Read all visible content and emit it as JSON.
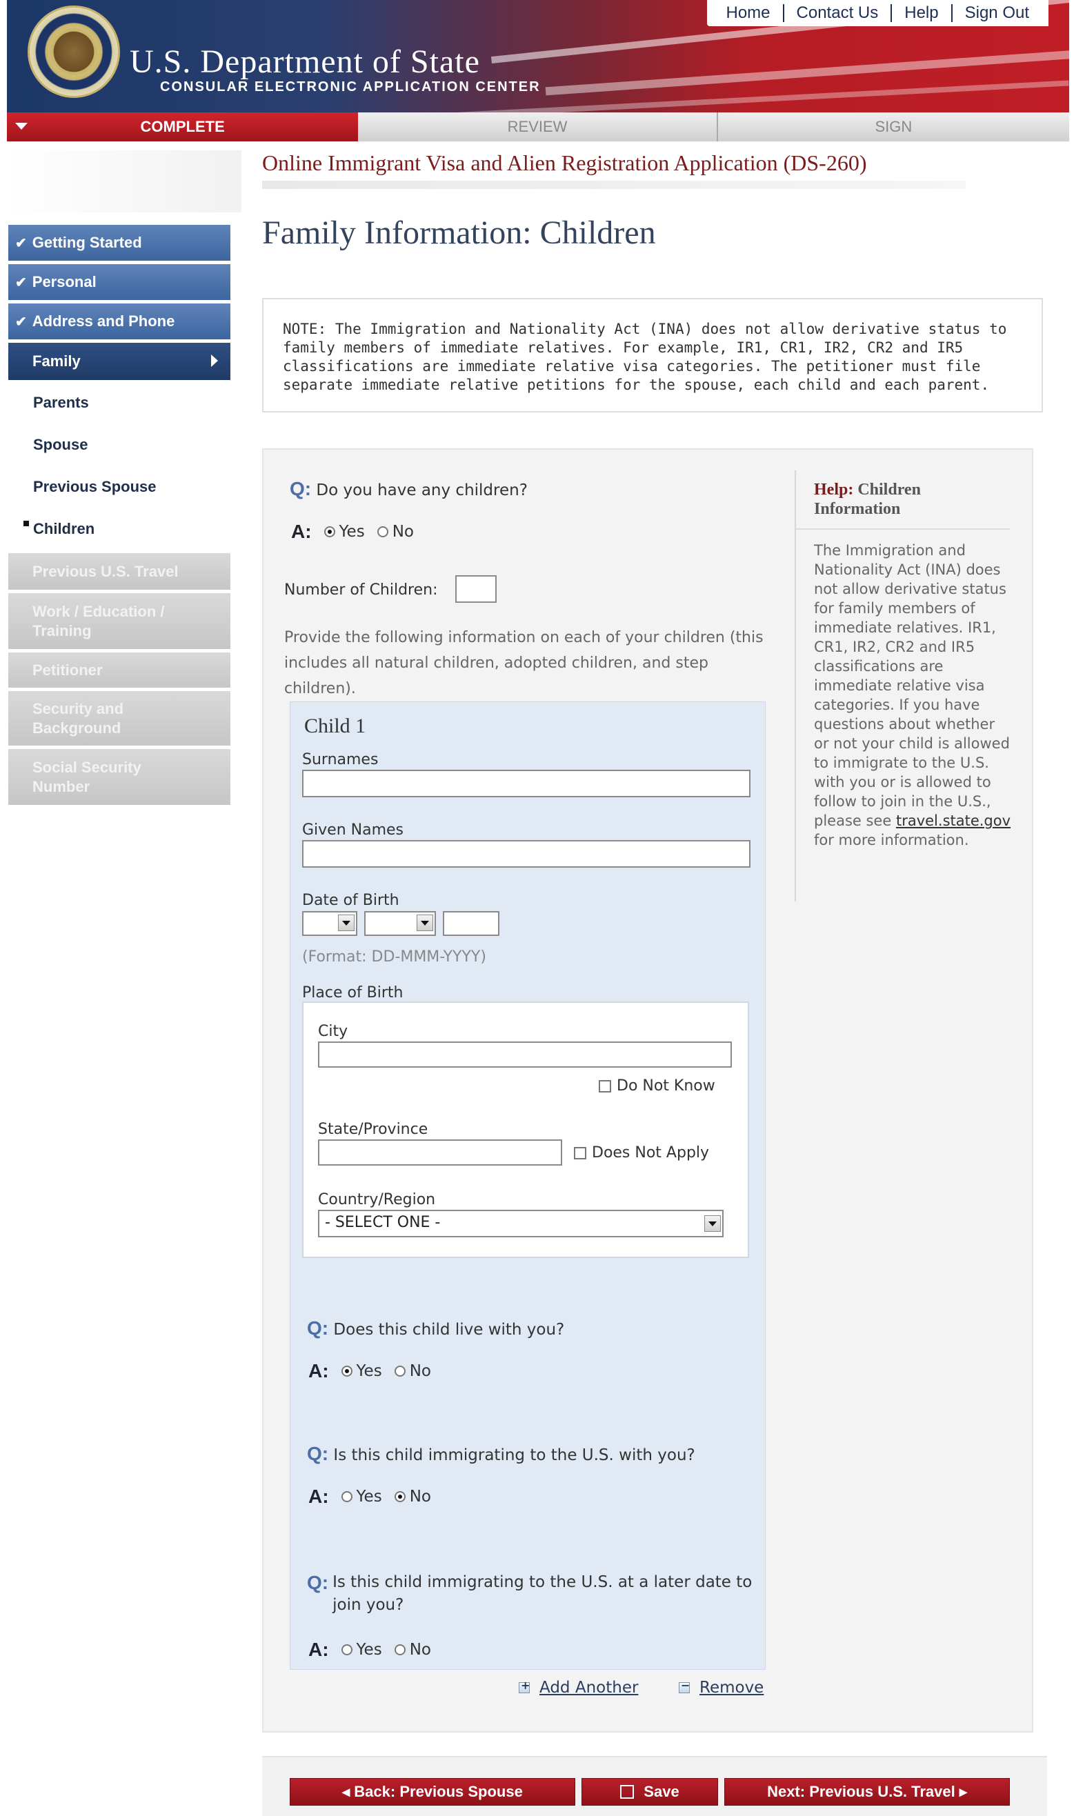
{
  "header": {
    "top_nav": [
      "Home",
      "Contact Us",
      "Help",
      "Sign Out"
    ],
    "title": "U.S. Department of State",
    "subtitle": "CONSULAR ELECTRONIC APPLICATION CENTER"
  },
  "progress_tabs": [
    "COMPLETE",
    "REVIEW",
    "SIGN"
  ],
  "form_title": "Online Immigrant Visa and Alien Registration Application (DS-260)",
  "page_heading": "Family Information: Children",
  "sidebar": {
    "completed": [
      "Getting Started",
      "Personal",
      "Address and Phone"
    ],
    "current": "Family",
    "sub_items": [
      "Parents",
      "Spouse",
      "Previous Spouse",
      "Children"
    ],
    "disabled": [
      "Previous U.S. Travel",
      "Work / Education / Training",
      "Petitioner",
      "Security and Background",
      "Social Security Number"
    ]
  },
  "note": "NOTE: The Immigration and Nationality Act (INA) does not allow derivative status to family members of immediate relatives. For example, IR1, CR1, IR2, CR2 and IR5 classifications are immediate relative visa categories. The petitioner must file separate immediate relative petitions for the spouse, each child and each parent.",
  "form": {
    "q_label": "Q:",
    "a_label": "A:",
    "yes": "Yes",
    "no": "No",
    "q_children": "Do you have any children?",
    "num_children_label": "Number of Children:",
    "instructions": "Provide the following information on each of your children (this includes all natural children, adopted children, and step children).",
    "child_title": "Child 1",
    "surnames_label": "Surnames",
    "given_names_label": "Given Names",
    "dob_label": "Date of Birth",
    "dob_format": "(Format: DD-MMM-YYYY)",
    "pob_label": "Place of Birth",
    "city_label": "City",
    "do_not_know": "Do Not Know",
    "state_label": "State/Province",
    "does_not_apply": "Does Not Apply",
    "country_label": "Country/Region",
    "country_value": "- SELECT ONE -",
    "q_live": "Does this child live with you?",
    "q_immigrating": "Is this child immigrating to the U.S. with you?",
    "q_later": "Is this child immigrating to the U.S. at a later date to join you?",
    "add_another": "Add Another",
    "remove": "Remove"
  },
  "help": {
    "title_accent": "Help:",
    "title_rest": "Children Information",
    "body": "The Immigration and Nationality Act (INA) does not allow derivative status for family members of immediate relatives. IR1, CR1, IR2, CR2 and IR5 classifications are immediate relative visa categories. If you have questions about whether or not your child is allowed to immigrate to the U.S. with you or is allowed to follow to join in the U.S., please see",
    "link": "travel.state.gov",
    "body_end": "for more information."
  },
  "nav": {
    "back": "◂ Back: Previous Spouse",
    "save": "Save",
    "next": "Next: Previous U.S. Travel ▸"
  },
  "colors": {
    "accent_red": "#b51d25",
    "navy": "#1f3a66",
    "sidebar_done": "#4a72ad"
  }
}
